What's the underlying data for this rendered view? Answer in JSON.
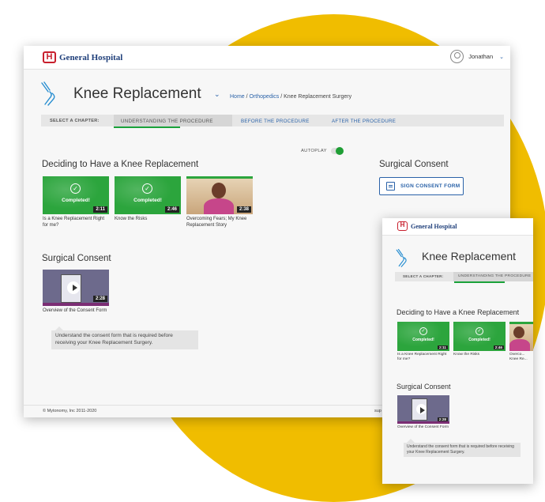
{
  "brand": {
    "name": "General Hospital",
    "logo_letter": "H",
    "accent": "#c81f2d",
    "brand_color": "#1f3f7a"
  },
  "user": {
    "name": "Jonathan",
    "chevron": "⌄"
  },
  "page": {
    "title": "Knee Replacement",
    "title_chevron": "⌄"
  },
  "breadcrumb": {
    "home": "Home",
    "sep1": " / ",
    "category": "Orthopedics",
    "sep2": " / ",
    "current": "Knee Replacement Surgery"
  },
  "chapters": {
    "label": "SELECT A CHAPTER:",
    "tabs": [
      {
        "label": "UNDERSTANDING THE PROCEDURE",
        "active": true
      },
      {
        "label": "BEFORE THE PROCEDURE",
        "active": false
      },
      {
        "label": "AFTER THE PROCEDURE",
        "active": false
      }
    ]
  },
  "autoplay": {
    "label": "AUTOPLAY",
    "on": true
  },
  "section1": {
    "title": "Deciding to Have a Knee Replacement",
    "videos": [
      {
        "status": "Completed!",
        "duration": "2:11",
        "caption": "Is a Knee Replacement Right for me?"
      },
      {
        "status": "Completed!",
        "duration": "2:46",
        "caption": "Know the Risks"
      },
      {
        "status": "",
        "duration": "2:38",
        "caption": "Overcoming Fears; My Knee Replacement Story",
        "caption_mobile": "Overco... Knee Re..."
      }
    ]
  },
  "section2": {
    "title": "Surgical Consent",
    "video": {
      "duration": "2:28",
      "caption": "Overview of the Consent Form"
    },
    "tooltip": "Understand the consent form that is required before receiving your Knee Replacement Surgery."
  },
  "sidebar": {
    "title": "Surgical Consent",
    "button": "SIGN CONSENT FORM"
  },
  "footer": {
    "copyright": "© Mytonomy, Inc 2011-2020",
    "support": "sup"
  },
  "colors": {
    "green": "#2ca53d",
    "link": "#2a62a8",
    "yellow": "#f0bd00"
  },
  "icons": [
    "hospital-logo-icon",
    "user-avatar-icon",
    "chevron-down-icon",
    "knee-joint-icon",
    "check-circle-icon",
    "play-icon",
    "consent-form-icon"
  ]
}
